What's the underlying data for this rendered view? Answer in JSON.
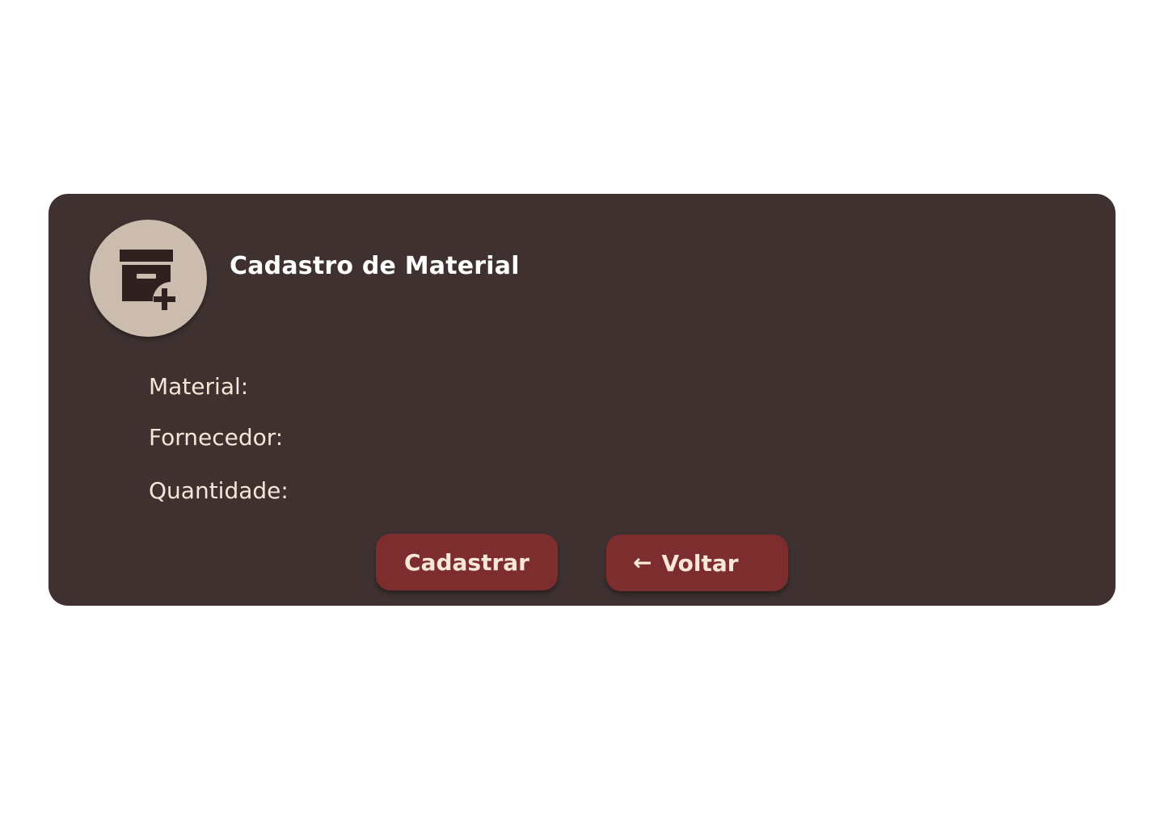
{
  "card": {
    "title": "Cadastro de Material",
    "icon": "archive-add-icon",
    "fields": {
      "material_label": "Material:",
      "fornecedor_label": "Fornecedor:",
      "quantidade_label": "Quantidade:"
    },
    "buttons": {
      "cadastrar_label": "Cadastrar",
      "voltar_label": "Voltar",
      "voltar_icon": "arrow-left-icon",
      "voltar_arrow": "←"
    }
  },
  "colors": {
    "card_bg": "#3f3130",
    "avatar_bg": "#cbbcad",
    "button_bg": "#7d2d2e",
    "button_text": "#f8e6d6",
    "label_text": "#f5e6d8",
    "icon_fill": "#2e2120"
  }
}
